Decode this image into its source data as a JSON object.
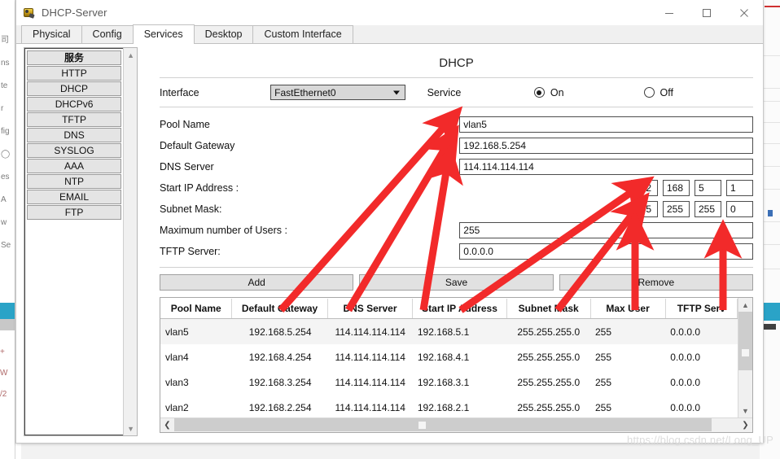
{
  "window": {
    "title": "DHCP-Server",
    "icon": "server-icon",
    "controls": {
      "minimize": "minimize-icon",
      "maximize": "maximize-icon",
      "close": "close-icon"
    }
  },
  "tabs": [
    {
      "label": "Physical",
      "active": false
    },
    {
      "label": "Config",
      "active": false
    },
    {
      "label": "Services",
      "active": true
    },
    {
      "label": "Desktop",
      "active": false
    },
    {
      "label": "Custom Interface",
      "active": false
    }
  ],
  "sidebar": {
    "header": "服务",
    "items": [
      {
        "label": "HTTP"
      },
      {
        "label": "DHCP"
      },
      {
        "label": "DHCPv6"
      },
      {
        "label": "TFTP"
      },
      {
        "label": "DNS"
      },
      {
        "label": "SYSLOG"
      },
      {
        "label": "AAA"
      },
      {
        "label": "NTP"
      },
      {
        "label": "EMAIL"
      },
      {
        "label": "FTP"
      }
    ]
  },
  "panel": {
    "title": "DHCP",
    "interface": {
      "label": "Interface",
      "value": "FastEthernet0"
    },
    "service": {
      "label": "Service",
      "on_label": "On",
      "off_label": "Off",
      "selected": "On"
    },
    "fields": {
      "pool_name_label": "Pool Name",
      "pool_name_value": "vlan5",
      "default_gateway_label": "Default Gateway",
      "default_gateway_value": "192.168.5.254",
      "dns_server_label": "DNS Server",
      "dns_server_value": "114.114.114.114",
      "start_ip_label": "Start IP Address :",
      "start_ip_octets": [
        "192",
        "168",
        "5",
        "1"
      ],
      "subnet_mask_label": "Subnet Mask:",
      "subnet_mask_octets": [
        "255",
        "255",
        "255",
        "0"
      ],
      "max_users_label": "Maximum number of Users :",
      "max_users_value": "255",
      "tftp_server_label": "TFTP Server:",
      "tftp_server_value": "0.0.0.0"
    },
    "buttons": {
      "add": "Add",
      "save": "Save",
      "remove": "Remove"
    },
    "table": {
      "headers": [
        "Pool Name",
        "Default Gateway",
        "DNS Server",
        "Start IP Address",
        "Subnet Mask",
        "Max User",
        "TFTP Serv"
      ],
      "rows": [
        [
          "vlan5",
          "192.168.5.254",
          "114.114.114.114",
          "192.168.5.1",
          "255.255.255.0",
          "255",
          "0.0.0.0"
        ],
        [
          "vlan4",
          "192.168.4.254",
          "114.114.114.114",
          "192.168.4.1",
          "255.255.255.0",
          "255",
          "0.0.0.0"
        ],
        [
          "vlan3",
          "192.168.3.254",
          "114.114.114.114",
          "192.168.3.1",
          "255.255.255.0",
          "255",
          "0.0.0.0"
        ],
        [
          "vlan2",
          "192.168.2.254",
          "114.114.114.114",
          "192.168.2.1",
          "255.255.255.0",
          "255",
          "0.0.0.0"
        ]
      ]
    }
  },
  "annotation": {
    "color": "#F22A2A",
    "arrow_count": 7
  },
  "watermark": "https://blog.csdn.net/Long_UP"
}
